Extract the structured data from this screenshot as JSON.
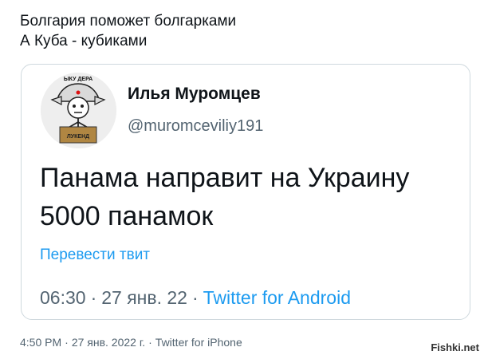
{
  "outer_tweet": {
    "lines": [
      "Болгария поможет болгарками",
      "А Куба - кубиками"
    ],
    "time": "4:50 PM",
    "date": "27 янв. 2022 г.",
    "source": "Twitter for iPhone"
  },
  "quoted_tweet": {
    "display_name": "Илья Муромцев",
    "handle": "@muromceviliy191",
    "text_lines": [
      "Панама направит на Украину",
      "5000 панамок"
    ],
    "translate_label": "Перевести твит",
    "time": "06:30",
    "date": "27 янв. 22",
    "source": "Twitter for Android",
    "avatar_caption_top": "ЫКУ ДЕРА",
    "avatar_caption_bottom": "ЛУКЕНД"
  },
  "watermark": "Fishki.net",
  "separator": "·",
  "colors": {
    "link": "#1d9bf0",
    "secondary_text": "#536471",
    "primary_text": "#0f1419",
    "card_border": "#cfd9de"
  }
}
